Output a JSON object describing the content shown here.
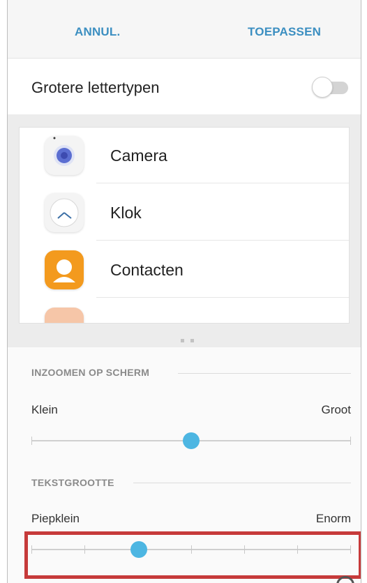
{
  "topbar": {
    "cancel_label": "ANNUL.",
    "apply_label": "TOEPASSEN"
  },
  "large_fonts": {
    "label": "Grotere lettertypen",
    "enabled": false
  },
  "preview": {
    "apps": [
      {
        "name": "Camera",
        "icon": "camera-icon"
      },
      {
        "name": "Klok",
        "icon": "clock-icon"
      },
      {
        "name": "Contacten",
        "icon": "contacts-icon"
      }
    ],
    "page_count": 2,
    "current_page": 1
  },
  "screen_zoom": {
    "title": "INZOOMEN OP SCHERM",
    "min_label": "Klein",
    "max_label": "Groot",
    "level": 0.5
  },
  "text_size": {
    "title": "TEKSTGROOTTE",
    "min_label": "Piepklein",
    "max_label": "Enorm",
    "steps": 7,
    "selected_step": 2
  },
  "colors": {
    "accent": "#3c8fc1",
    "slider_thumb": "#4db6e2",
    "contacts_icon": "#f39a1e",
    "highlight": "#c63a3a"
  }
}
